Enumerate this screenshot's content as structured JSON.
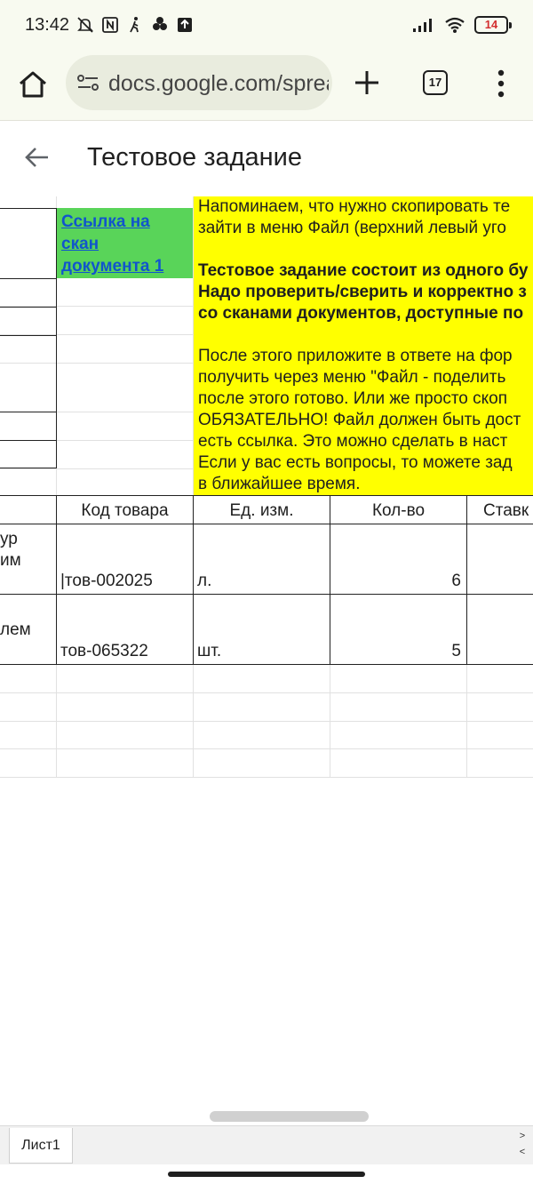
{
  "status_bar": {
    "time": "13:42",
    "battery": "14",
    "icons": [
      "mute-icon",
      "nfc-icon",
      "walk-icon",
      "dots-icon",
      "upload-icon",
      "signal-icon",
      "wifi-icon",
      "battery-icon"
    ]
  },
  "browser": {
    "url": "docs.google.com/spreadsheets",
    "tab_count": "17"
  },
  "app": {
    "title": "Тестовое задание"
  },
  "sheet": {
    "link_text": "Ссылка на скан документа 1",
    "note_lines": [
      "Напоминаем, что нужно скопировать те",
      "зайти в меню Файл (верхний левый уго"
    ],
    "note_bold_lines": [
      "Тестовое задание состоит из одного бу",
      "Надо проверить/сверить и корректно з",
      "со сканами документов, доступные по"
    ],
    "note_tail_lines": [
      "После этого приложите в ответе на фор",
      "получить через меню \"Файл - поделить",
      "после этого готово. Или же просто скоп",
      "ОБЯЗАТЕЛЬНО! Файл должен быть дост",
      "есть ссылка. Это можно сделать в наст",
      "Если у вас есть вопросы, то можете зад",
      "в ближайшее время."
    ],
    "headers": {
      "code": "Код товара",
      "unit": "Ед. изм.",
      "qty": "Кол-во",
      "rate": "Ставк"
    },
    "rows": [
      {
        "frag1": "ур",
        "frag2": "им",
        "code": "|тов-002025",
        "unit": "л.",
        "qty": "6"
      },
      {
        "frag1": "лем",
        "frag2": "",
        "code": "тов-065322",
        "unit": "шт.",
        "qty": "5"
      }
    ],
    "tab_name": "Лист1",
    "tab_arrows": [
      ">",
      "<"
    ]
  }
}
